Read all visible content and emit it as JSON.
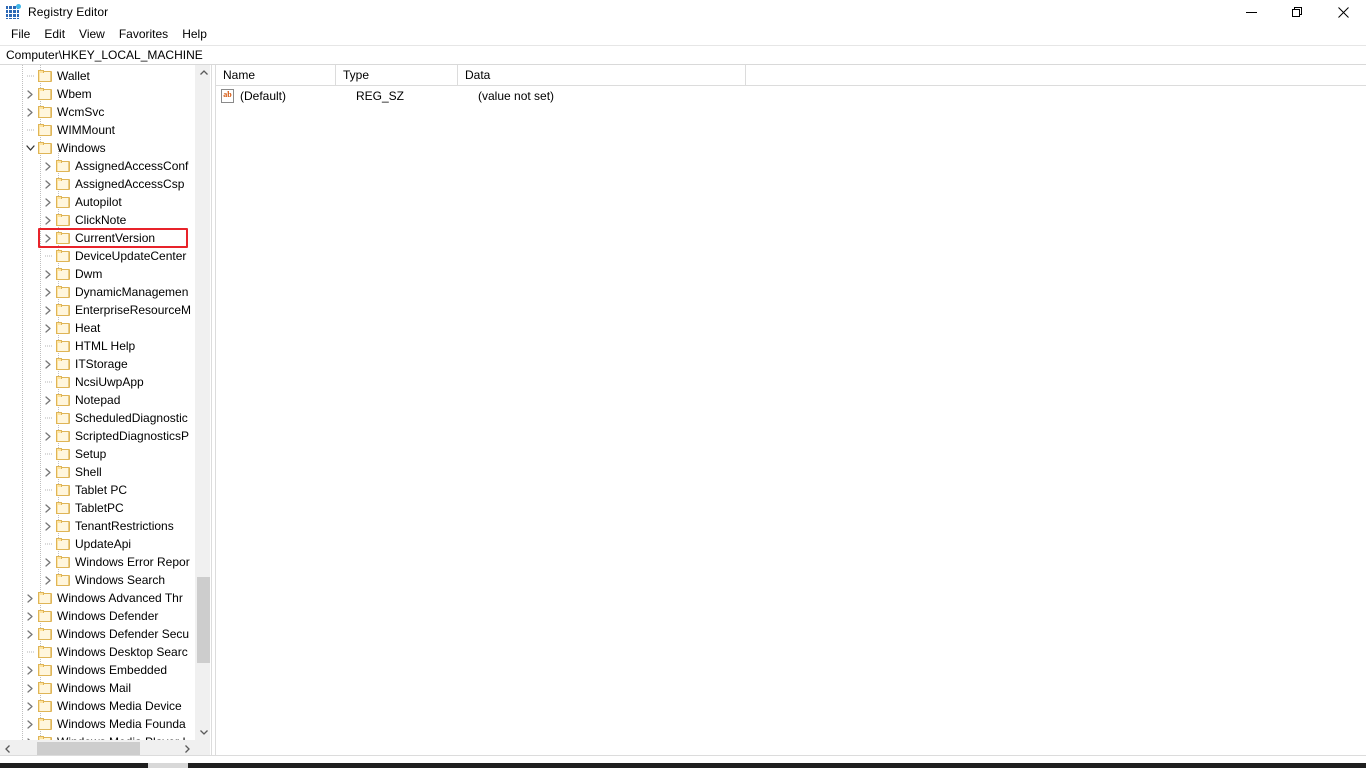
{
  "window": {
    "title": "Registry Editor",
    "icon": "registry-icon",
    "minimize_label": "Minimize",
    "maximize_label": "Maximize",
    "close_label": "Close"
  },
  "menu": {
    "items": [
      {
        "label": "File"
      },
      {
        "label": "Edit"
      },
      {
        "label": "View"
      },
      {
        "label": "Favorites"
      },
      {
        "label": "Help"
      }
    ]
  },
  "address": {
    "path": "Computer\\HKEY_LOCAL_MACHINE"
  },
  "tree": {
    "selected_key": "CurrentVersion",
    "highlight_color": "#e8232a",
    "items": [
      {
        "label": "Wallet",
        "depth": 1,
        "expander": "none"
      },
      {
        "label": "Wbem",
        "depth": 1,
        "expander": "collapsed"
      },
      {
        "label": "WcmSvc",
        "depth": 1,
        "expander": "collapsed"
      },
      {
        "label": "WIMMount",
        "depth": 1,
        "expander": "none"
      },
      {
        "label": "Windows",
        "depth": 1,
        "expander": "expanded"
      },
      {
        "label": "AssignedAccessConf",
        "depth": 2,
        "expander": "collapsed"
      },
      {
        "label": "AssignedAccessCsp",
        "depth": 2,
        "expander": "collapsed"
      },
      {
        "label": "Autopilot",
        "depth": 2,
        "expander": "collapsed"
      },
      {
        "label": "ClickNote",
        "depth": 2,
        "expander": "collapsed"
      },
      {
        "label": "CurrentVersion",
        "depth": 2,
        "expander": "collapsed",
        "highlighted": true
      },
      {
        "label": "DeviceUpdateCenter",
        "depth": 2,
        "expander": "none"
      },
      {
        "label": "Dwm",
        "depth": 2,
        "expander": "collapsed"
      },
      {
        "label": "DynamicManagemen",
        "depth": 2,
        "expander": "collapsed"
      },
      {
        "label": "EnterpriseResourceM",
        "depth": 2,
        "expander": "collapsed"
      },
      {
        "label": "Heat",
        "depth": 2,
        "expander": "collapsed"
      },
      {
        "label": "HTML Help",
        "depth": 2,
        "expander": "none"
      },
      {
        "label": "ITStorage",
        "depth": 2,
        "expander": "collapsed"
      },
      {
        "label": "NcsiUwpApp",
        "depth": 2,
        "expander": "none"
      },
      {
        "label": "Notepad",
        "depth": 2,
        "expander": "collapsed"
      },
      {
        "label": "ScheduledDiagnostic",
        "depth": 2,
        "expander": "none"
      },
      {
        "label": "ScriptedDiagnosticsP",
        "depth": 2,
        "expander": "collapsed"
      },
      {
        "label": "Setup",
        "depth": 2,
        "expander": "none"
      },
      {
        "label": "Shell",
        "depth": 2,
        "expander": "collapsed"
      },
      {
        "label": "Tablet PC",
        "depth": 2,
        "expander": "none"
      },
      {
        "label": "TabletPC",
        "depth": 2,
        "expander": "collapsed"
      },
      {
        "label": "TenantRestrictions",
        "depth": 2,
        "expander": "collapsed"
      },
      {
        "label": "UpdateApi",
        "depth": 2,
        "expander": "none"
      },
      {
        "label": "Windows Error Repor",
        "depth": 2,
        "expander": "collapsed"
      },
      {
        "label": "Windows Search",
        "depth": 2,
        "expander": "collapsed"
      },
      {
        "label": "Windows Advanced Thr",
        "depth": 1,
        "expander": "collapsed"
      },
      {
        "label": "Windows Defender",
        "depth": 1,
        "expander": "collapsed"
      },
      {
        "label": "Windows Defender Secu",
        "depth": 1,
        "expander": "collapsed"
      },
      {
        "label": "Windows Desktop Searc",
        "depth": 1,
        "expander": "none"
      },
      {
        "label": "Windows Embedded",
        "depth": 1,
        "expander": "collapsed"
      },
      {
        "label": "Windows Mail",
        "depth": 1,
        "expander": "collapsed"
      },
      {
        "label": "Windows Media Device",
        "depth": 1,
        "expander": "collapsed"
      },
      {
        "label": "Windows Media Founda",
        "depth": 1,
        "expander": "collapsed"
      },
      {
        "label": "Windows Media Player I",
        "depth": 1,
        "expander": "collapsed"
      }
    ]
  },
  "values": {
    "columns": [
      {
        "label": "Name"
      },
      {
        "label": "Type"
      },
      {
        "label": "Data"
      }
    ],
    "rows": [
      {
        "name": "(Default)",
        "type": "REG_SZ",
        "data": "(value not set)",
        "icon": "string-value-icon"
      }
    ]
  }
}
